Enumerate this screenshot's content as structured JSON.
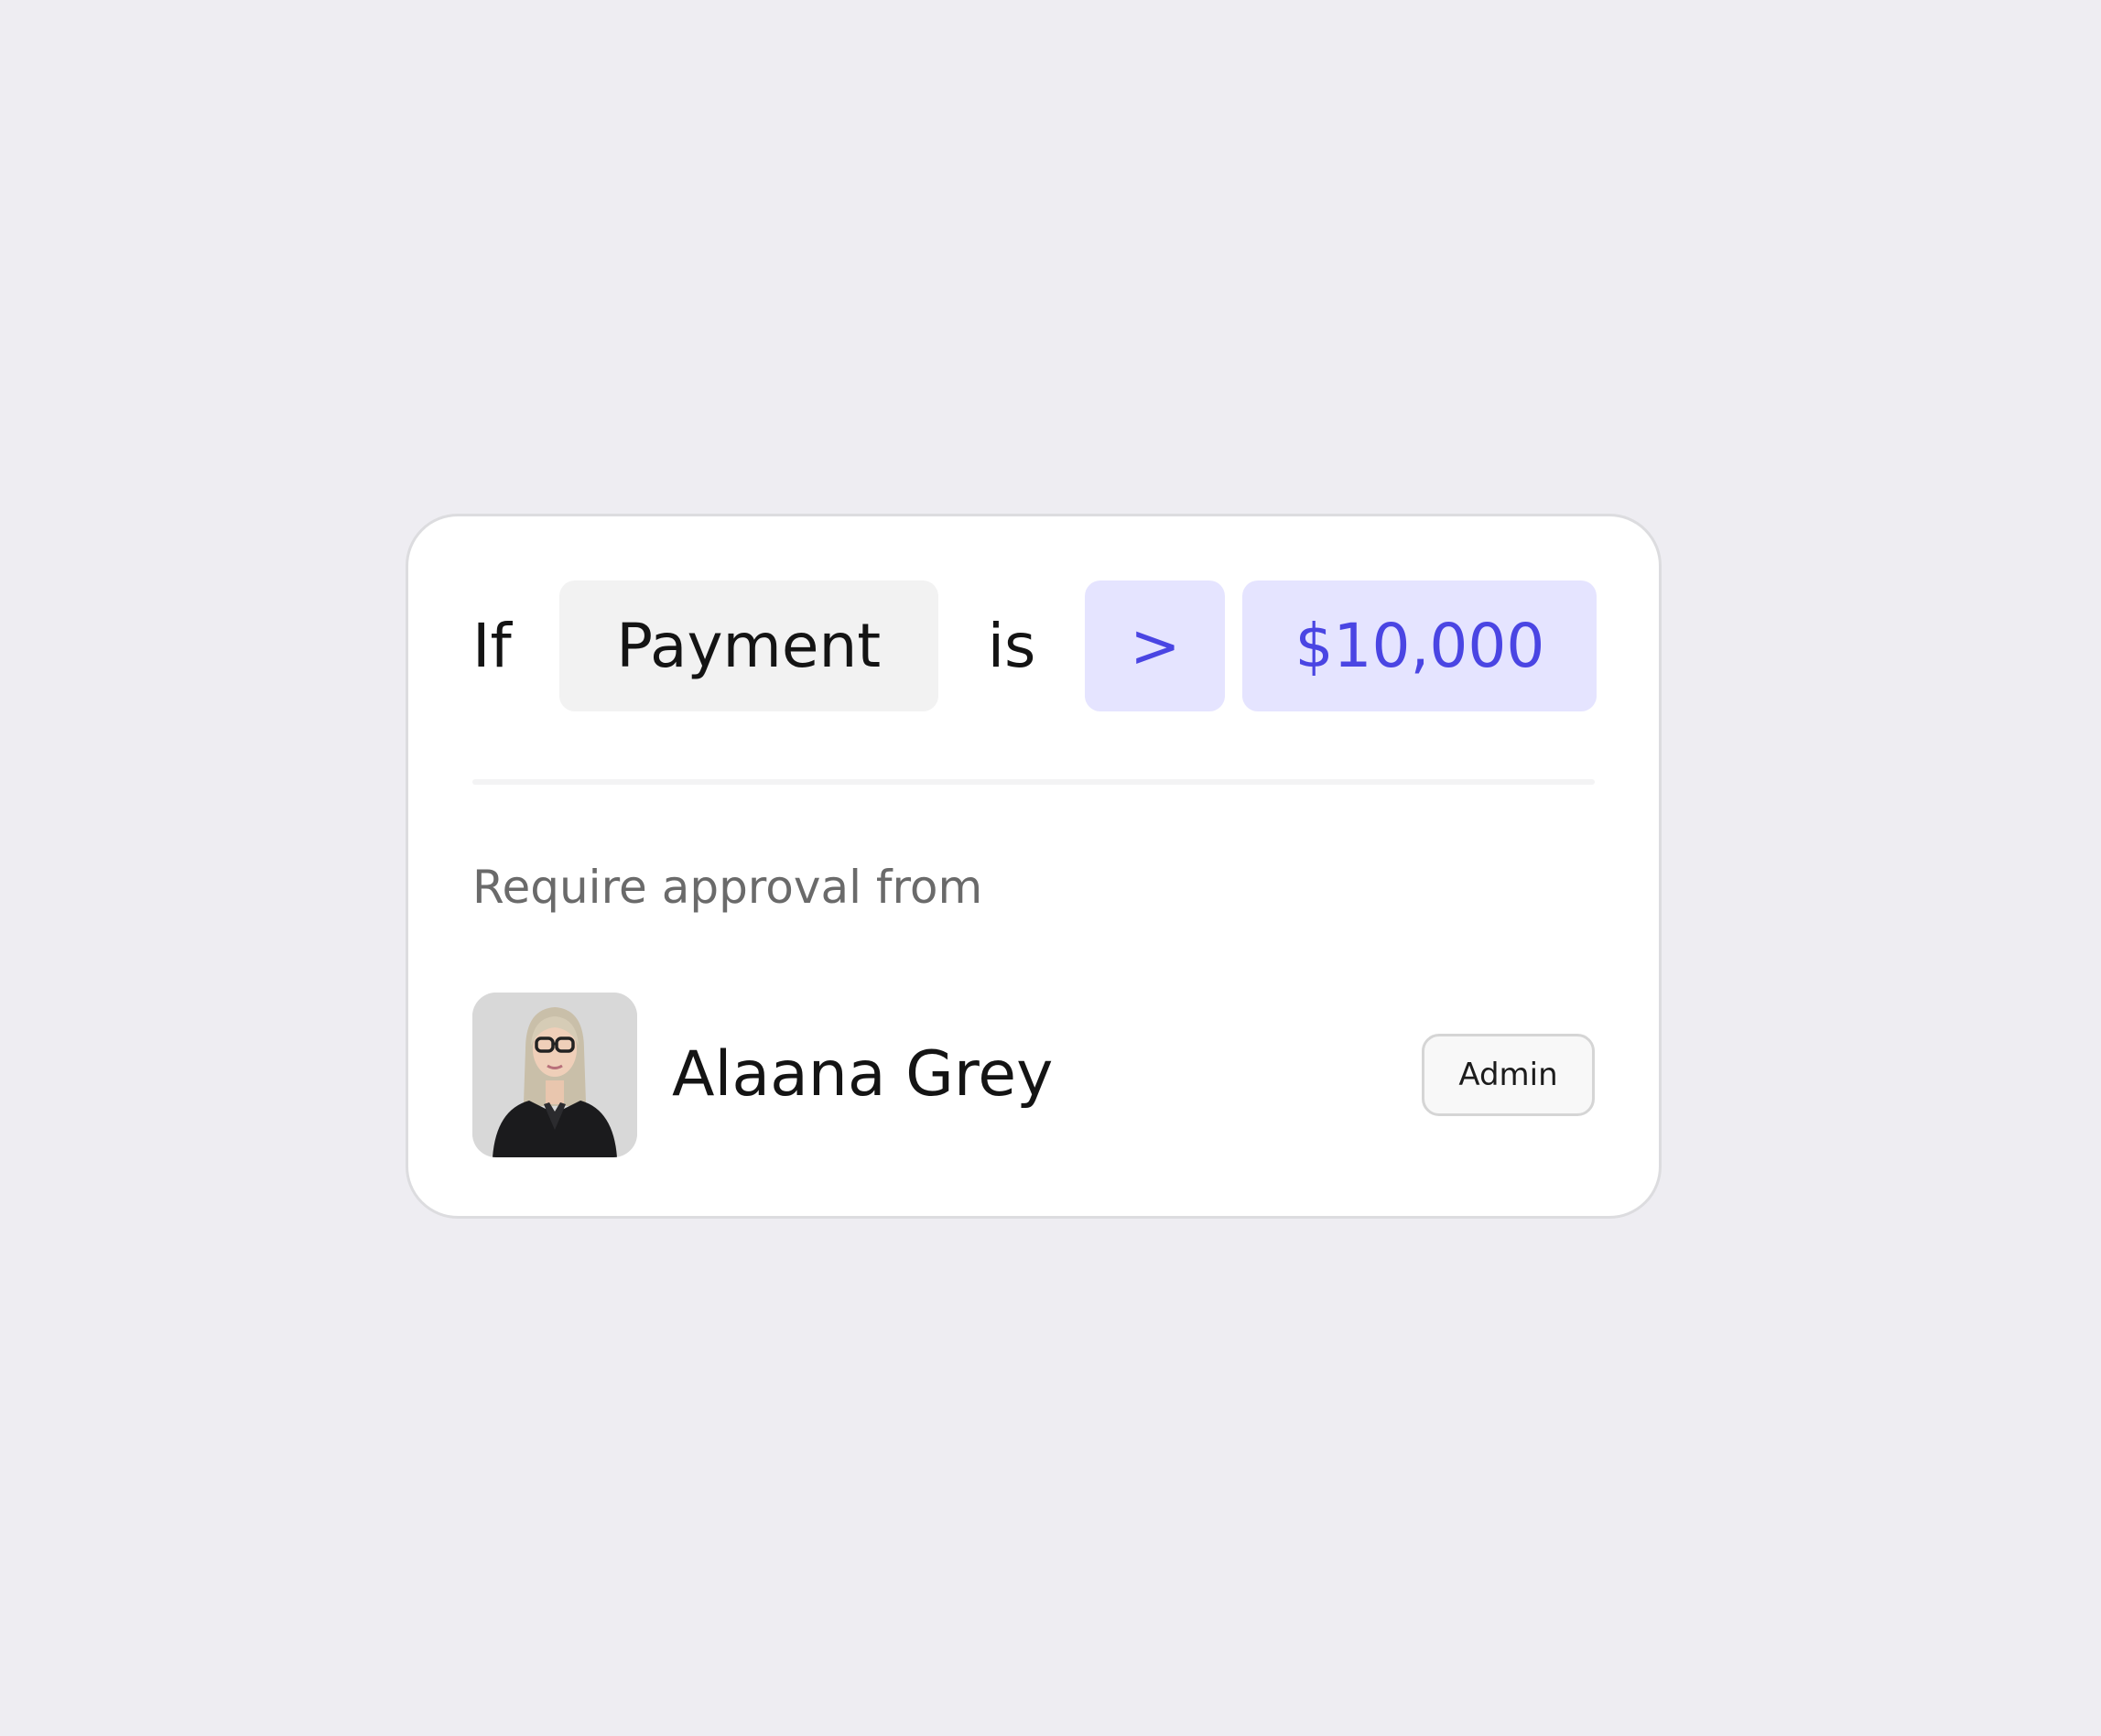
{
  "rule": {
    "if_word": "If",
    "field": "Payment",
    "is_word": "is",
    "operator": ">",
    "value": "$10,000"
  },
  "approval": {
    "label": "Require approval from",
    "approver": {
      "name": "Alaana Grey",
      "role": "Admin"
    }
  },
  "colors": {
    "background": "#eeedf2",
    "card": "#ffffff",
    "accent": "#4a45e3",
    "accent_bg": "#e5e4ff",
    "field_bg": "#f2f2f2"
  }
}
